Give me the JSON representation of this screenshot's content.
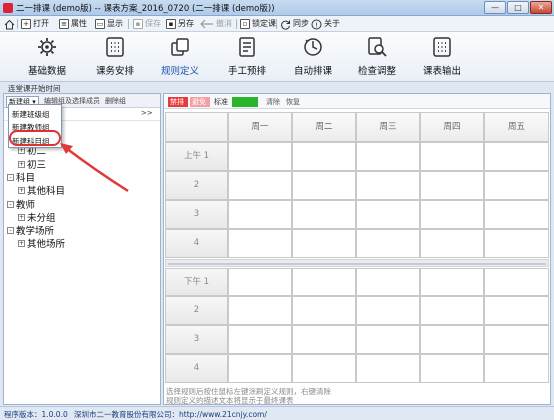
{
  "window": {
    "title": "二一排课 (demo版) -- 课表方案_2016_0720 (二一排课 (demo版))",
    "buttons": {
      "min": "—",
      "max": "□",
      "close": "✕"
    }
  },
  "small_toolbar": {
    "items": [
      {
        "label": "",
        "icon": "home-icon",
        "enabled": true
      },
      {
        "label": "打开",
        "icon": "open-icon",
        "enabled": true
      },
      {
        "label": "属性",
        "icon": "properties-icon",
        "enabled": true
      },
      {
        "label": "显示",
        "icon": "display-icon",
        "enabled": true
      },
      {
        "label": "保存",
        "icon": "save-icon",
        "enabled": false
      },
      {
        "label": "另存",
        "icon": "save-as-icon",
        "enabled": true
      },
      {
        "label": "撤消",
        "icon": "undo-icon",
        "enabled": false
      },
      {
        "label": "锁定课",
        "icon": "lock-icon",
        "enabled": true
      },
      {
        "label": "同步",
        "icon": "sync-icon",
        "enabled": true
      },
      {
        "label": "关于",
        "icon": "about-icon",
        "enabled": true
      }
    ]
  },
  "main_toolbar": {
    "items": [
      {
        "label": "基础数据",
        "icon": "gear-icon",
        "active": false
      },
      {
        "label": "课务安排",
        "icon": "grid-icon",
        "active": false
      },
      {
        "label": "规则定义",
        "icon": "rules-icon",
        "active": true
      },
      {
        "label": "手工预排",
        "icon": "manual-icon",
        "active": false
      },
      {
        "label": "自动排课",
        "icon": "auto-icon",
        "active": false
      },
      {
        "label": "检查调整",
        "icon": "check-icon",
        "active": false
      },
      {
        "label": "课表输出",
        "icon": "output-icon",
        "active": false
      }
    ]
  },
  "section_label": "连堂课开始时间",
  "left_panel": {
    "toolbar": {
      "new_group": "新建组",
      "edit_group": "编辑组及选择成员",
      "delete_group": "删除组"
    },
    "arrows": ">>",
    "dropdown_items": [
      "新建班级组",
      "新建教师组",
      "新建科目组"
    ],
    "tree": [
      {
        "label": "初二",
        "level": 1,
        "toggle": "+"
      },
      {
        "label": "初三",
        "level": 1,
        "toggle": "+"
      },
      {
        "label": "科目",
        "level": 0,
        "toggle": "-"
      },
      {
        "label": "其他科目",
        "level": 1,
        "toggle": "+"
      },
      {
        "label": "教师",
        "level": 0,
        "toggle": "-"
      },
      {
        "label": "未分组",
        "level": 1,
        "toggle": "+"
      },
      {
        "label": "教学场所",
        "level": 0,
        "toggle": "-"
      },
      {
        "label": "其他场所",
        "level": 1,
        "toggle": "+"
      }
    ]
  },
  "right_panel": {
    "chips": [
      "禁排",
      "避免",
      "标准",
      "",
      "清除",
      "恢复"
    ],
    "chip_colors": {
      "ban": "#e53b3b",
      "avoid": "#f2a0a0",
      "preferred": "#2ab52a"
    },
    "days": [
      "周一",
      "周二",
      "周三",
      "周四",
      "周五"
    ],
    "morning": [
      "上午 1",
      "2",
      "3",
      "4"
    ],
    "afternoon": [
      "下午 1",
      "2",
      "3",
      "4"
    ],
    "help_lines": [
      "选择规则后按住鼠标左键涂刷定义规则，右键清除",
      "规则定义的描述文本将显示于最终课表"
    ]
  },
  "status_bar": {
    "version": "程序版本：1.0.0.0",
    "company": "深圳市二一教育股份有限公司：http://www.21cnjy.com/"
  }
}
